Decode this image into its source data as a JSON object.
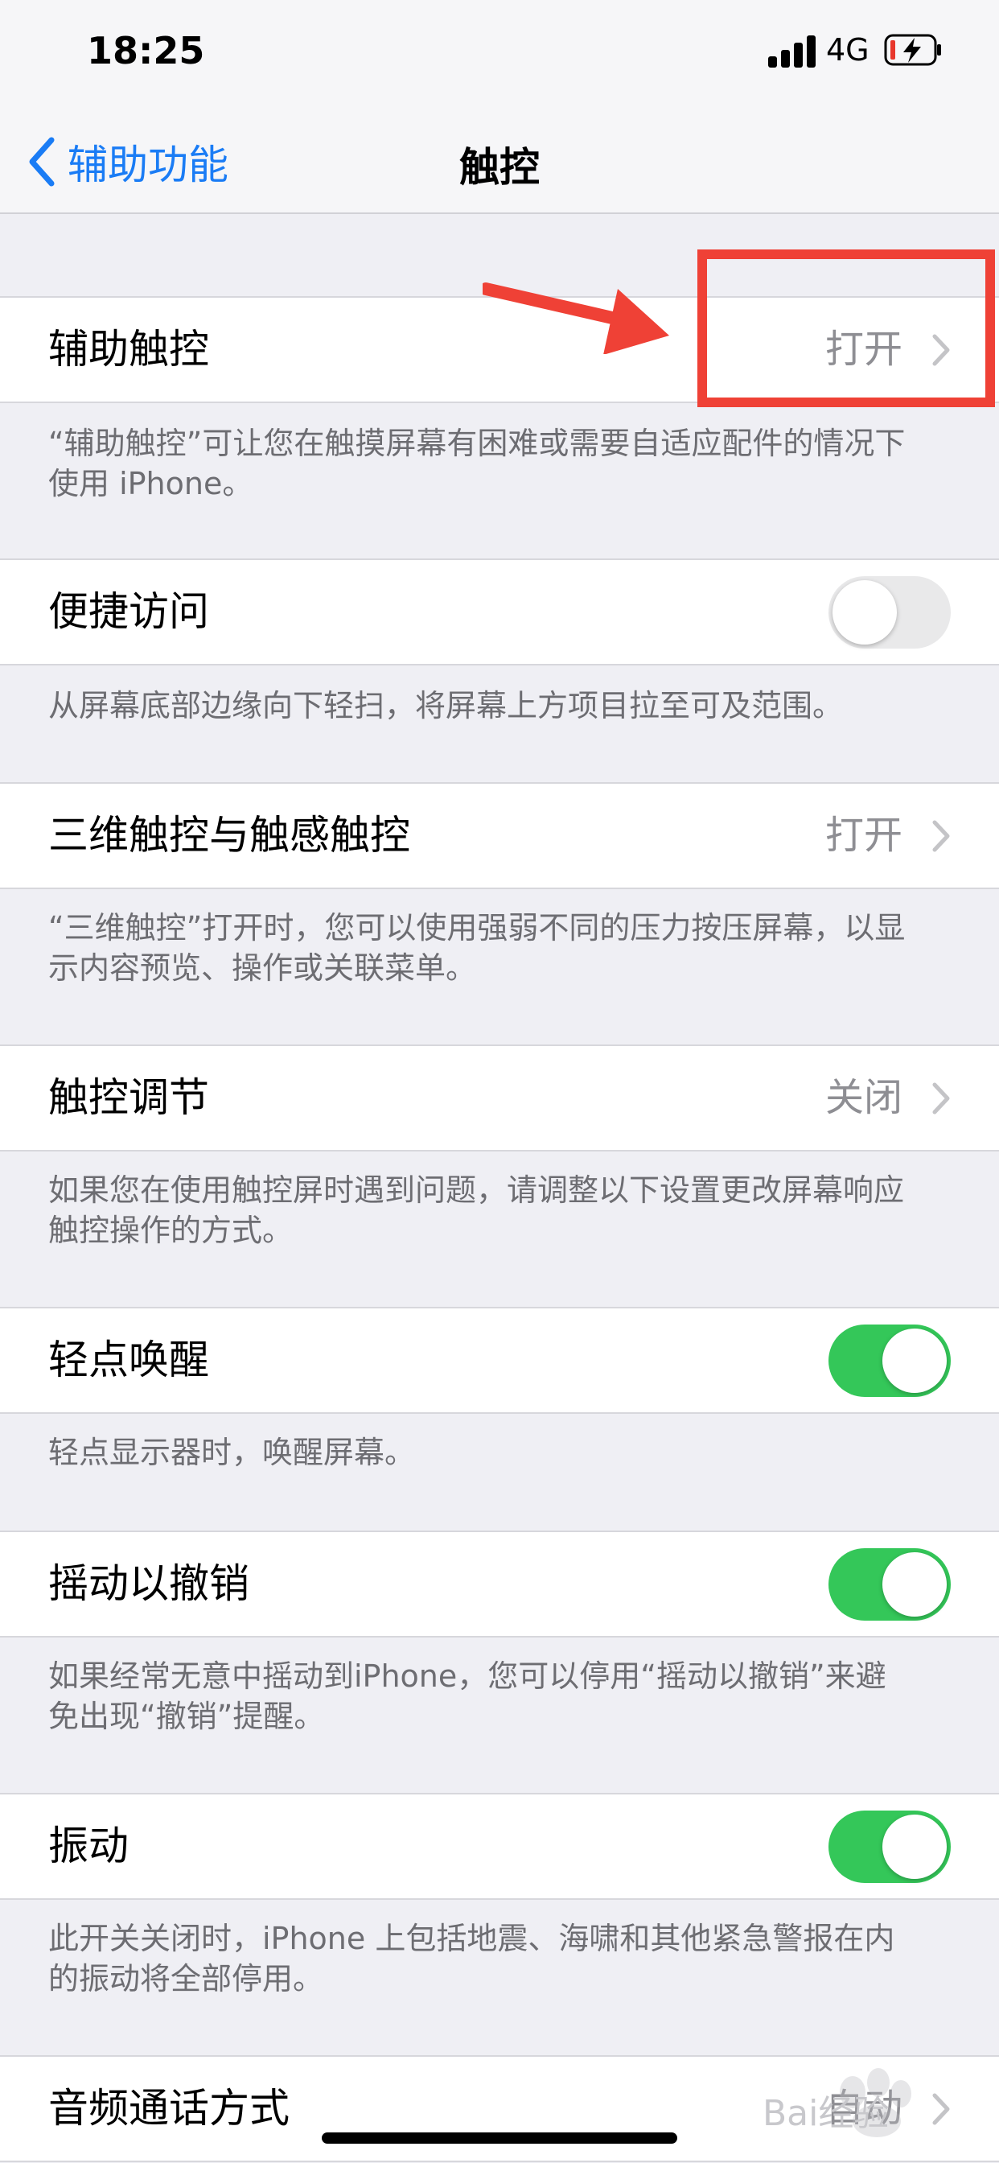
{
  "status_bar": {
    "time": "18:25",
    "network": "4G",
    "battery_charging": true
  },
  "nav": {
    "back_label": "辅助功能",
    "title": "触控"
  },
  "sections": [
    {
      "label": "辅助触控",
      "control": "disclosure",
      "value": "打开",
      "footer": "“辅助触控”可让您在触摸屏幕有困难或需要自适应配件的情况下\n使用 iPhone。"
    },
    {
      "label": "便捷访问",
      "control": "toggle",
      "on": false,
      "footer": "从屏幕底部边缘向下轻扫，将屏幕上方项目拉至可及范围。"
    },
    {
      "label": "三维触控与触感触控",
      "control": "disclosure",
      "value": "打开",
      "footer": "“三维触控”打开时，您可以使用强弱不同的压力按压屏幕，以显\n示内容预览、操作或关联菜单。"
    },
    {
      "label": "触控调节",
      "control": "disclosure",
      "value": "关闭",
      "footer": "如果您在使用触控屏时遇到问题，请调整以下设置更改屏幕响应\n触控操作的方式。"
    },
    {
      "label": "轻点唤醒",
      "control": "toggle",
      "on": true,
      "footer": "轻点显示器时，唤醒屏幕。"
    },
    {
      "label": "摇动以撤销",
      "control": "toggle",
      "on": true,
      "footer": "如果经常无意中摇动到iPhone，您可以停用“摇动以撤销”来避\n免出现“撤销”提醒。"
    },
    {
      "label": "振动",
      "control": "toggle",
      "on": true,
      "footer": "此开关关闭时，iPhone 上包括地震、海啸和其他紧急警报在内\n的振动将全部停用。"
    },
    {
      "label": "音频通话方式",
      "control": "disclosure",
      "value": "自动"
    }
  ],
  "annotation": {
    "color": "#ef4136",
    "target": "辅助触控 value"
  },
  "watermark": "Bai经验",
  "colors": {
    "accent": "#1a7cf5",
    "toggle_on": "#34c759",
    "toggle_off": "#e9e9ea",
    "secondary_text": "#8e8e93",
    "background": "#efeff4"
  }
}
